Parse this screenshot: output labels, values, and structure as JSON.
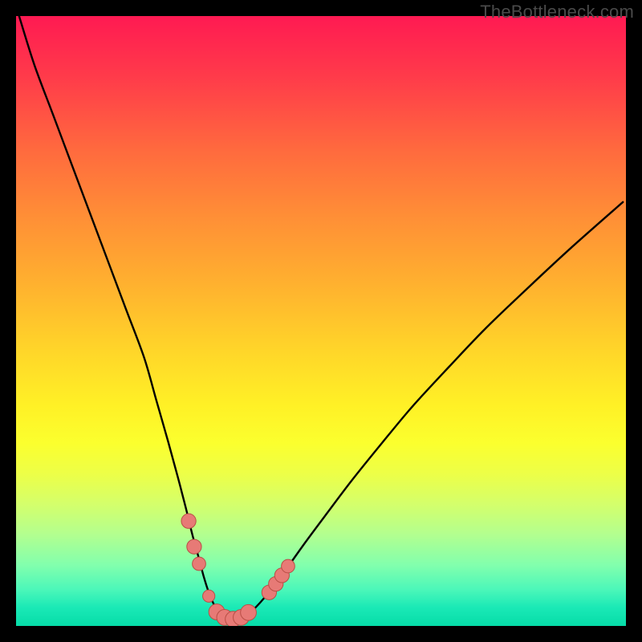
{
  "watermark": "TheBottleneck.com",
  "colors": {
    "curve": "#000000",
    "marker_fill": "#e77a76",
    "marker_stroke": "#b94e45",
    "frame": "#000000"
  },
  "chart_data": {
    "type": "line",
    "title": "",
    "xlabel": "",
    "ylabel": "",
    "xlim": [
      0,
      100
    ],
    "ylim": [
      0,
      100
    ],
    "grid": false,
    "legend": "none",
    "series": [
      {
        "name": "bottleneck-curve",
        "x": [
          0.5,
          3,
          6,
          9,
          12,
          15,
          18,
          21,
          23,
          25,
          26.5,
          27.8,
          28.9,
          30.0,
          30.8,
          31.6,
          32.4,
          33.1,
          33.8,
          34.6,
          35.4,
          36.4,
          37.4,
          38.5,
          40.0,
          42.0,
          44.5,
          47.5,
          51,
          55,
          60,
          65,
          71,
          77,
          84,
          91,
          99.5
        ],
        "values": [
          100,
          92,
          84,
          76,
          68,
          60,
          52,
          44,
          37,
          30,
          24.5,
          19.5,
          15.0,
          11.0,
          8.0,
          5.5,
          3.6,
          2.3,
          1.5,
          1.1,
          1.0,
          1.1,
          1.5,
          2.3,
          3.8,
          6.2,
          9.6,
          13.8,
          18.5,
          23.8,
          30.0,
          36.0,
          42.5,
          48.8,
          55.5,
          62.0,
          69.5
        ]
      }
    ],
    "annotations": {
      "markers": [
        {
          "x": 28.3,
          "y": 17.2,
          "r": 1.2
        },
        {
          "x": 29.2,
          "y": 13.0,
          "r": 1.2
        },
        {
          "x": 30.0,
          "y": 10.2,
          "r": 1.1
        },
        {
          "x": 31.6,
          "y": 4.9,
          "r": 1.0
        },
        {
          "x": 32.9,
          "y": 2.3,
          "r": 1.3
        },
        {
          "x": 34.2,
          "y": 1.4,
          "r": 1.3
        },
        {
          "x": 35.6,
          "y": 1.1,
          "r": 1.3
        },
        {
          "x": 36.9,
          "y": 1.4,
          "r": 1.3
        },
        {
          "x": 38.1,
          "y": 2.2,
          "r": 1.3
        },
        {
          "x": 41.5,
          "y": 5.5,
          "r": 1.2
        },
        {
          "x": 42.6,
          "y": 6.9,
          "r": 1.2
        },
        {
          "x": 43.6,
          "y": 8.3,
          "r": 1.2
        },
        {
          "x": 44.6,
          "y": 9.8,
          "r": 1.1
        }
      ]
    }
  }
}
